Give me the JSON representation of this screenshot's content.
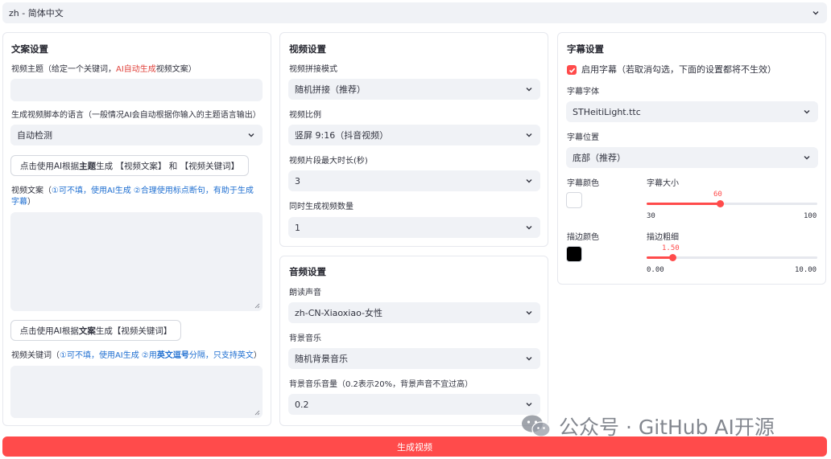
{
  "language_select": {
    "value": "zh - 简体中文"
  },
  "script_settings": {
    "title": "文案设置",
    "subject_label": {
      "prefix": "视频主题（给定一个关键词，",
      "highlight": "AI自动生成",
      "suffix": "视频文案）"
    },
    "subject_value": "",
    "language_label": "生成视频脚本的语言（一般情况AI会自动根据你输入的主题语言输出）",
    "language_value": "自动检测",
    "gen_script_btn": {
      "part1": "点击使用AI根据",
      "bold": "主题",
      "part2": "生成 【视频文案】 和 【视频关键词】"
    },
    "script_label": {
      "prefix": "视频文案（",
      "hint": "①可不填，使用AI生成 ②合理使用标点断句，有助于生成字幕",
      "suffix": "）"
    },
    "script_value": "",
    "gen_keywords_btn": {
      "part1": "点击使用AI根据",
      "bold": "文案",
      "part2": "生成【视频关键词】"
    },
    "keywords_label": {
      "prefix": "视频关键词（",
      "hint1": "①可不填，使用AI生成 ②用",
      "bold": "英文逗号",
      "hint2": "分隔，只支持英文",
      "suffix": "）"
    },
    "keywords_value": ""
  },
  "video_settings": {
    "title": "视频设置",
    "concat_label": "视频拼接模式",
    "concat_value": "随机拼接（推荐）",
    "ratio_label": "视频比例",
    "ratio_value": "竖屏 9:16（抖音视频）",
    "clip_label": "视频片段最大时长(秒)",
    "clip_value": "3",
    "count_label": "同时生成视频数量",
    "count_value": "1"
  },
  "audio_settings": {
    "title": "音频设置",
    "voice_label": "朗读声音",
    "voice_value": "zh-CN-Xiaoxiao-女性",
    "bgm_label": "背景音乐",
    "bgm_value": "随机背景音乐",
    "volume_label": "背景音乐音量（0.2表示20%，背景声音不宜过高）",
    "volume_value": "0.2"
  },
  "subtitle_settings": {
    "title": "字幕设置",
    "enable_label": "启用字幕（若取消勾选，下面的设置都将不生效）",
    "enable_checked": true,
    "font_label": "字幕字体",
    "font_value": "STHeitiLight.ttc",
    "position_label": "字幕位置",
    "position_value": "底部（推荐）",
    "color_label": "字幕颜色",
    "color_value": "#FFFFFF",
    "size_label": "字幕大小",
    "size_slider": {
      "value": "60",
      "min": "30",
      "max": "100",
      "fraction": 0.4286
    },
    "stroke_color_label": "描边颜色",
    "stroke_color_value": "#000000",
    "stroke_width_label": "描边粗细",
    "stroke_slider": {
      "value": "1.50",
      "min": "0.00",
      "max": "10.00",
      "fraction": 0.15
    }
  },
  "generate_button": "生成视频",
  "watermark": "公众号 · GitHub AI开源",
  "colors": {
    "accent": "#ff4b4b",
    "input_bg": "#f0f2f6",
    "link": "#1f6fd1"
  }
}
